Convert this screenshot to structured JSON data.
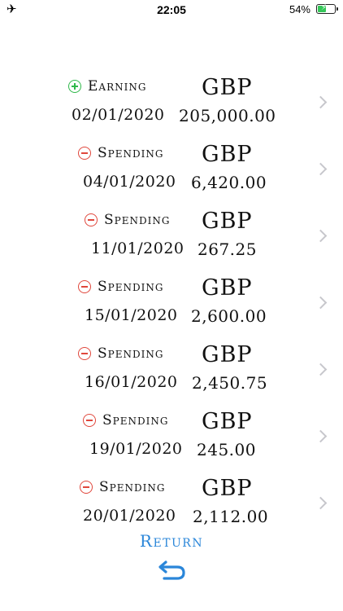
{
  "status_bar": {
    "time": "22:05",
    "battery_percent": "54%",
    "battery_level": 0.54,
    "airplane_icon": "airplane-icon"
  },
  "transactions": [
    {
      "type": "Earning",
      "sign": "plus",
      "currency": "GBP",
      "date": "02/01/2020",
      "amount": "205,000.00"
    },
    {
      "type": "Spending",
      "sign": "minus",
      "currency": "GBP",
      "date": "04/01/2020",
      "amount": "6,420.00"
    },
    {
      "type": "Spending",
      "sign": "minus",
      "currency": "GBP",
      "date": "11/01/2020",
      "amount": "267.25"
    },
    {
      "type": "Spending",
      "sign": "minus",
      "currency": "GBP",
      "date": "15/01/2020",
      "amount": "2,600.00"
    },
    {
      "type": "Spending",
      "sign": "minus",
      "currency": "GBP",
      "date": "16/01/2020",
      "amount": "2,450.75"
    },
    {
      "type": "Spending",
      "sign": "minus",
      "currency": "GBP",
      "date": "19/01/2020",
      "amount": "245.00"
    },
    {
      "type": "Spending",
      "sign": "minus",
      "currency": "GBP",
      "date": "20/01/2020",
      "amount": "2,112.00"
    }
  ],
  "footer": {
    "return_label": "Return",
    "return_icon": "return-arrow-icon"
  },
  "colors": {
    "earning": "#2fb84a",
    "spending": "#e0473c",
    "accent": "#2a86d9",
    "chevron": "#c7c7cc"
  }
}
